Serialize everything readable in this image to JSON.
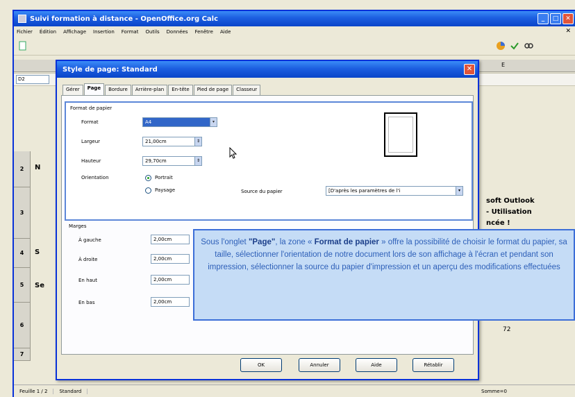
{
  "app": {
    "title": "Suivi formation à distance - OpenOffice.org Calc",
    "menu": [
      "Fichier",
      "Édition",
      "Affichage",
      "Insertion",
      "Format",
      "Outils",
      "Données",
      "Fenêtre",
      "Aide"
    ],
    "namebox_value": "D2"
  },
  "sheet": {
    "row_headers": [
      "2",
      "3",
      "4",
      "5",
      "6",
      "7"
    ],
    "cells": {
      "r2_partial": "N",
      "r3_text_1": "soft  Outlook",
      "r3_text_2": "-  Utilisation",
      "r3_text_3": "ncée !",
      "r4_partial": "S",
      "r5_partial": "Se",
      "r6_value": "72",
      "col_e": "E"
    }
  },
  "status": {
    "sheet": "Feuille 1 / 2",
    "style": "Standard",
    "sum": "Somme=0"
  },
  "dialog": {
    "title": "Style de page: Standard",
    "tabs": [
      "Gérer",
      "Page",
      "Bordure",
      "Arrière-plan",
      "En-tête",
      "Pied de page",
      "Classeur"
    ],
    "active_tab": "Page",
    "paper_group_title": "Format de papier",
    "format_label": "Format",
    "format_value": "A4",
    "width_label": "Largeur",
    "width_value": "21,00cm",
    "height_label": "Hauteur",
    "height_value": "29,70cm",
    "orientation_label": "Orientation",
    "portrait_label": "Portrait",
    "landscape_label": "Paysage",
    "orientation_selected": "Portrait",
    "source_label": "Source du papier",
    "source_value": "[D'après les paramètres de l'i",
    "margins_group_title": "Marges",
    "margin_left_label": "À gauche",
    "margin_left_value": "2,00cm",
    "margin_right_label": "À droite",
    "margin_right_value": "2,00cm",
    "margin_top_label": "En haut",
    "margin_top_value": "2,00cm",
    "margin_bottom_label": "En bas",
    "margin_bottom_value": "2,00cm",
    "buttons": {
      "ok": "OK",
      "cancel": "Annuler",
      "help": "Aide",
      "reset": "Rétablir"
    }
  },
  "callout": {
    "prefix": "Sous l'onglet ",
    "tab_name": "\"Page\"",
    "mid": ", la zone « ",
    "zone_name": "Format de papier",
    "rest": " » offre la possibilité de choisir le format du papier, sa taille, sélectionner l'orientation de notre document lors de son affichage à l'écran et pendant son impression, sélectionner la source du papier d'impression et un aperçu des modifications effectuées"
  },
  "colors": {
    "title_bar": "#0a45c9",
    "callout_bg": "#c5dcf6",
    "callout_text": "#2d5fb8",
    "highlight_border": "#5c87d8"
  }
}
